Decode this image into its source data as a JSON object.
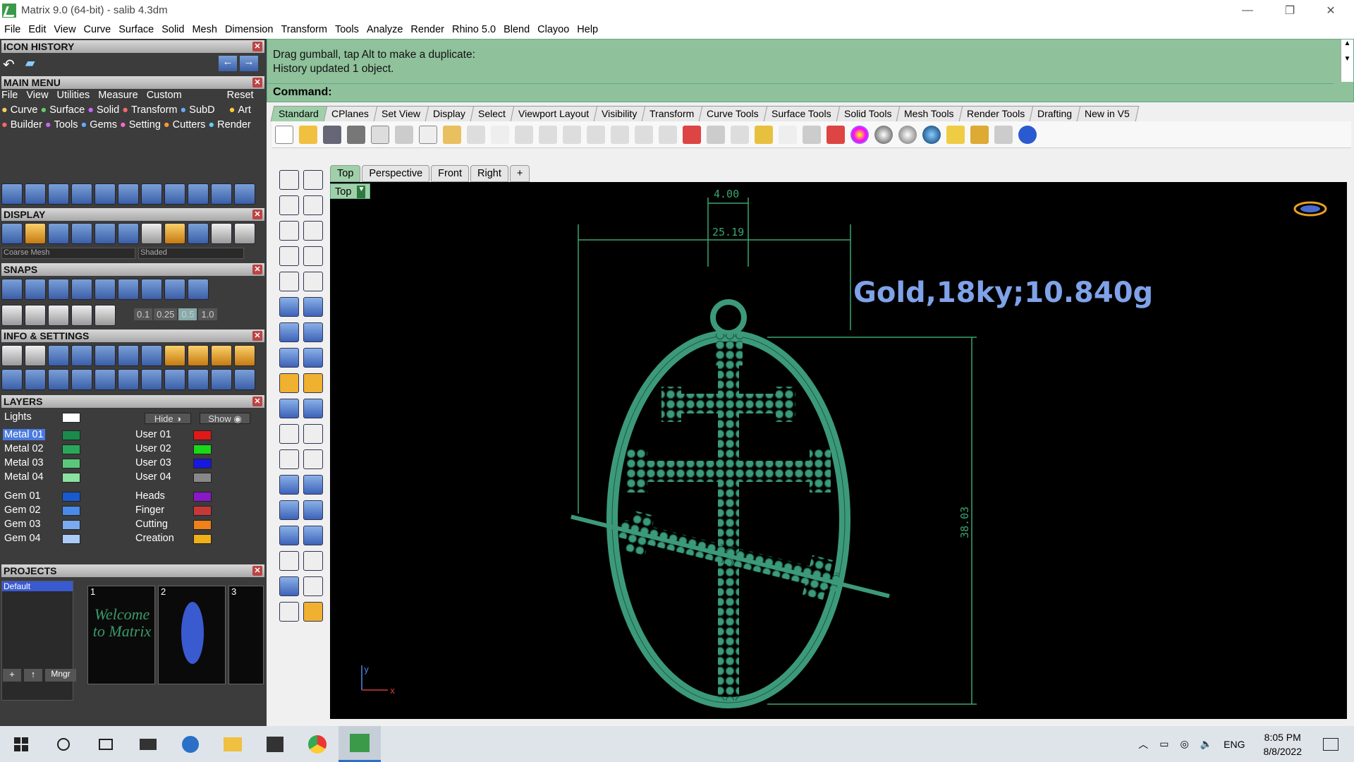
{
  "window": {
    "title": "Matrix 9.0 (64-bit) - salib 4.3dm"
  },
  "menu": [
    "File",
    "Edit",
    "View",
    "Curve",
    "Surface",
    "Solid",
    "Mesh",
    "Dimension",
    "Transform",
    "Tools",
    "Analyze",
    "Render",
    "Rhino 5.0",
    "Blend",
    "Clayoo",
    "Help"
  ],
  "panels": {
    "icon_history": "ICON HISTORY",
    "main_menu": "MAIN MENU",
    "main_menu_items": [
      "File",
      "View",
      "Utilities",
      "Measure",
      "Custom",
      "Reset"
    ],
    "main_menu_row1": [
      "Curve",
      "Surface",
      "Solid",
      "Transform",
      "SubD",
      "Art"
    ],
    "main_menu_row2": [
      "Builder",
      "Tools",
      "Gems",
      "Setting",
      "Cutters",
      "Render"
    ],
    "display": "DISPLAY",
    "display_mesh": "Coarse Mesh",
    "display_mode": "Shaded",
    "snaps": "SNAPS",
    "snap_values": [
      "0.1",
      "0.25",
      "0.5",
      "1.0"
    ],
    "info": "INFO & SETTINGS",
    "layers": "LAYERS",
    "layers_lights": "Lights",
    "hide": "Hide",
    "show": "Show",
    "layers_left": [
      "Metal 01",
      "Metal 02",
      "Metal 03",
      "Metal 04",
      "Gem 01",
      "Gem 02",
      "Gem 03",
      "Gem 04"
    ],
    "layers_right": [
      "User 01",
      "User 02",
      "User 03",
      "User 04",
      "Heads",
      "Finger",
      "Cutting",
      "Creation"
    ],
    "projects": "PROJECTS",
    "project_default": "Default",
    "project_nums": [
      "1",
      "2",
      "3"
    ],
    "welcome_text": "Welcome to Matrix",
    "mngr": "Mngr"
  },
  "command": {
    "line1": "Drag gumball, tap Alt to make a duplicate:",
    "line2": "History updated 1 object.",
    "prompt": "Command:"
  },
  "toolbar_tabs": [
    "Standard",
    "CPlanes",
    "Set View",
    "Display",
    "Select",
    "Viewport Layout",
    "Visibility",
    "Transform",
    "Curve Tools",
    "Surface Tools",
    "Solid Tools",
    "Mesh Tools",
    "Render Tools",
    "Drafting",
    "New in V5"
  ],
  "viewport_tabs": [
    "Top",
    "Perspective",
    "Front",
    "Right"
  ],
  "viewport": {
    "label": "Top",
    "weight_label": "Gold,18ky;10.840g",
    "dims": {
      "loop": "4.00",
      "width": "25.19",
      "height": "38.03"
    },
    "axis_y": "y",
    "axis_x": "x"
  },
  "taskbar": {
    "lang": "ENG",
    "time": "8:05 PM",
    "date": "8/8/2022"
  }
}
